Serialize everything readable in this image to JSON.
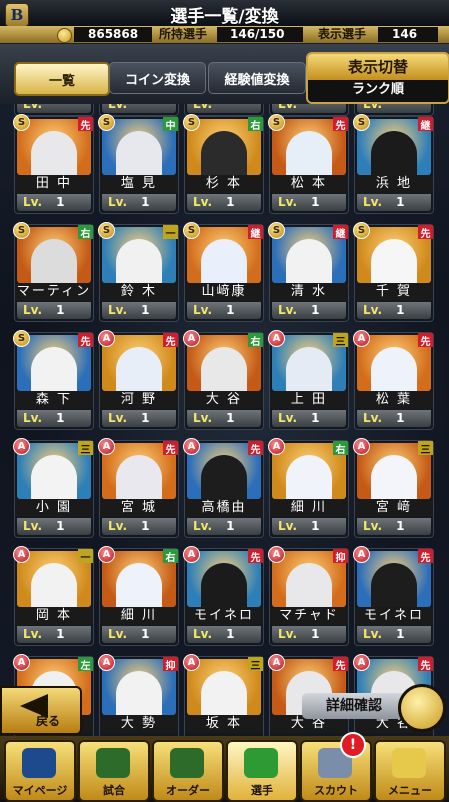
{
  "header": {
    "title": "選手一覧/変換",
    "logo": "B"
  },
  "status": {
    "coins": "865868",
    "owned_label": "所持選手",
    "owned_value": "146/150",
    "shown_label": "表示選手",
    "shown_value": "146"
  },
  "tabs": [
    {
      "label": "一覧",
      "active": true
    },
    {
      "label": "コイン変換",
      "active": false
    },
    {
      "label": "経験値変換",
      "active": false
    }
  ],
  "switcher": {
    "title": "表示切替",
    "value": "ランク順"
  },
  "top_partial": [
    {
      "lv": "Lv."
    },
    {
      "lv": "Lv."
    },
    {
      "lv": "Lv."
    },
    {
      "lv": "Lv."
    },
    {
      "lv": "Lv."
    }
  ],
  "cards": [
    {
      "rank": "S",
      "pos": "先",
      "name": "田 中",
      "lv": "Lv.",
      "level": "1",
      "color": "#e8e8ea"
    },
    {
      "rank": "S",
      "pos": "中",
      "name": "塩 見",
      "lv": "Lv.",
      "level": "1",
      "color": "#e7e7ee"
    },
    {
      "rank": "S",
      "pos": "右",
      "name": "杉 本",
      "lv": "Lv.",
      "level": "1",
      "color": "#2b2b2b"
    },
    {
      "rank": "S",
      "pos": "先",
      "name": "松 本",
      "lv": "Lv.",
      "level": "1",
      "color": "#e6eef8"
    },
    {
      "rank": "S",
      "pos": "継",
      "name": "浜 地",
      "lv": "Lv.",
      "level": "1",
      "color": "#1b1b1b"
    },
    {
      "rank": "S",
      "pos": "右",
      "name": "マーティン",
      "lv": "Lv.",
      "level": "1",
      "color": "#dcdcdc"
    },
    {
      "rank": "S",
      "pos": "一",
      "name": "鈴 木",
      "lv": "Lv.",
      "level": "1",
      "color": "#f1f1f1"
    },
    {
      "rank": "S",
      "pos": "継",
      "name": "山﨑康",
      "lv": "Lv.",
      "level": "1",
      "color": "#e9f0fb"
    },
    {
      "rank": "S",
      "pos": "継",
      "name": "清 水",
      "lv": "Lv.",
      "level": "1",
      "color": "#f2f2f2"
    },
    {
      "rank": "S",
      "pos": "先",
      "name": "千 賀",
      "lv": "Lv.",
      "level": "1",
      "color": "#f6f6f6"
    },
    {
      "rank": "S",
      "pos": "先",
      "name": "森 下",
      "lv": "Lv.",
      "level": "1",
      "color": "#f2f2f2"
    },
    {
      "rank": "A",
      "pos": "先",
      "name": "河 野",
      "lv": "Lv.",
      "level": "1",
      "color": "#e7eef8"
    },
    {
      "rank": "A",
      "pos": "右",
      "name": "大 谷",
      "lv": "Lv.",
      "level": "1",
      "color": "#e8e8e8"
    },
    {
      "rank": "A",
      "pos": "三",
      "name": "上 田",
      "lv": "Lv.",
      "level": "1",
      "color": "#e5ebf5"
    },
    {
      "rank": "A",
      "pos": "先",
      "name": "松 葉",
      "lv": "Lv.",
      "level": "1",
      "color": "#eef3fb"
    },
    {
      "rank": "A",
      "pos": "三",
      "name": "小 園",
      "lv": "Lv.",
      "level": "1",
      "color": "#f3f3f3"
    },
    {
      "rank": "A",
      "pos": "先",
      "name": "宮 城",
      "lv": "Lv.",
      "level": "1",
      "color": "#e8e8ee"
    },
    {
      "rank": "A",
      "pos": "先",
      "name": "高橋由",
      "lv": "Lv.",
      "level": "1",
      "color": "#1d1d1d"
    },
    {
      "rank": "A",
      "pos": "右",
      "name": "細 川",
      "lv": "Lv.",
      "level": "1",
      "color": "#f0f3fa"
    },
    {
      "rank": "A",
      "pos": "三",
      "name": "宮 﨑",
      "lv": "Lv.",
      "level": "1",
      "color": "#f3f5fb"
    },
    {
      "rank": "A",
      "pos": "一",
      "name": "岡 本",
      "lv": "Lv.",
      "level": "1",
      "color": "#f2f2f2"
    },
    {
      "rank": "A",
      "pos": "右",
      "name": "細 川",
      "lv": "Lv.",
      "level": "1",
      "color": "#eef2fa"
    },
    {
      "rank": "A",
      "pos": "先",
      "name": "モイネロ",
      "lv": "Lv.",
      "level": "1",
      "color": "#1b1b1b"
    },
    {
      "rank": "A",
      "pos": "抑",
      "name": "マチャド",
      "lv": "Lv.",
      "level": "1",
      "color": "#e8e8ea"
    },
    {
      "rank": "A",
      "pos": "先",
      "name": "モイネロ",
      "lv": "Lv.",
      "level": "1",
      "color": "#1d1d1d"
    },
    {
      "rank": "A",
      "pos": "左",
      "name": "",
      "lv": "",
      "level": "",
      "color": "#f0f0f0"
    },
    {
      "rank": "A",
      "pos": "抑",
      "name": "大 勢",
      "lv": "",
      "level": "",
      "color": "#f2f2f2"
    },
    {
      "rank": "A",
      "pos": "三",
      "name": "坂 本",
      "lv": "",
      "level": "",
      "color": "#f2f2f2"
    },
    {
      "rank": "A",
      "pos": "先",
      "name": "大 谷",
      "lv": "",
      "level": "",
      "color": "#e8e8ea"
    },
    {
      "rank": "A",
      "pos": "先",
      "name": "大 谷",
      "lv": "",
      "level": "",
      "color": "#e8e8ea"
    }
  ],
  "bottom": {
    "back_label": "戻る",
    "detail_label": "詳細確認",
    "badge": "!",
    "nav": [
      {
        "label": "マイページ"
      },
      {
        "label": "試合"
      },
      {
        "label": "オーダー"
      },
      {
        "label": "選手",
        "active": true
      },
      {
        "label": "スカウト"
      },
      {
        "label": "メニュー"
      }
    ]
  }
}
